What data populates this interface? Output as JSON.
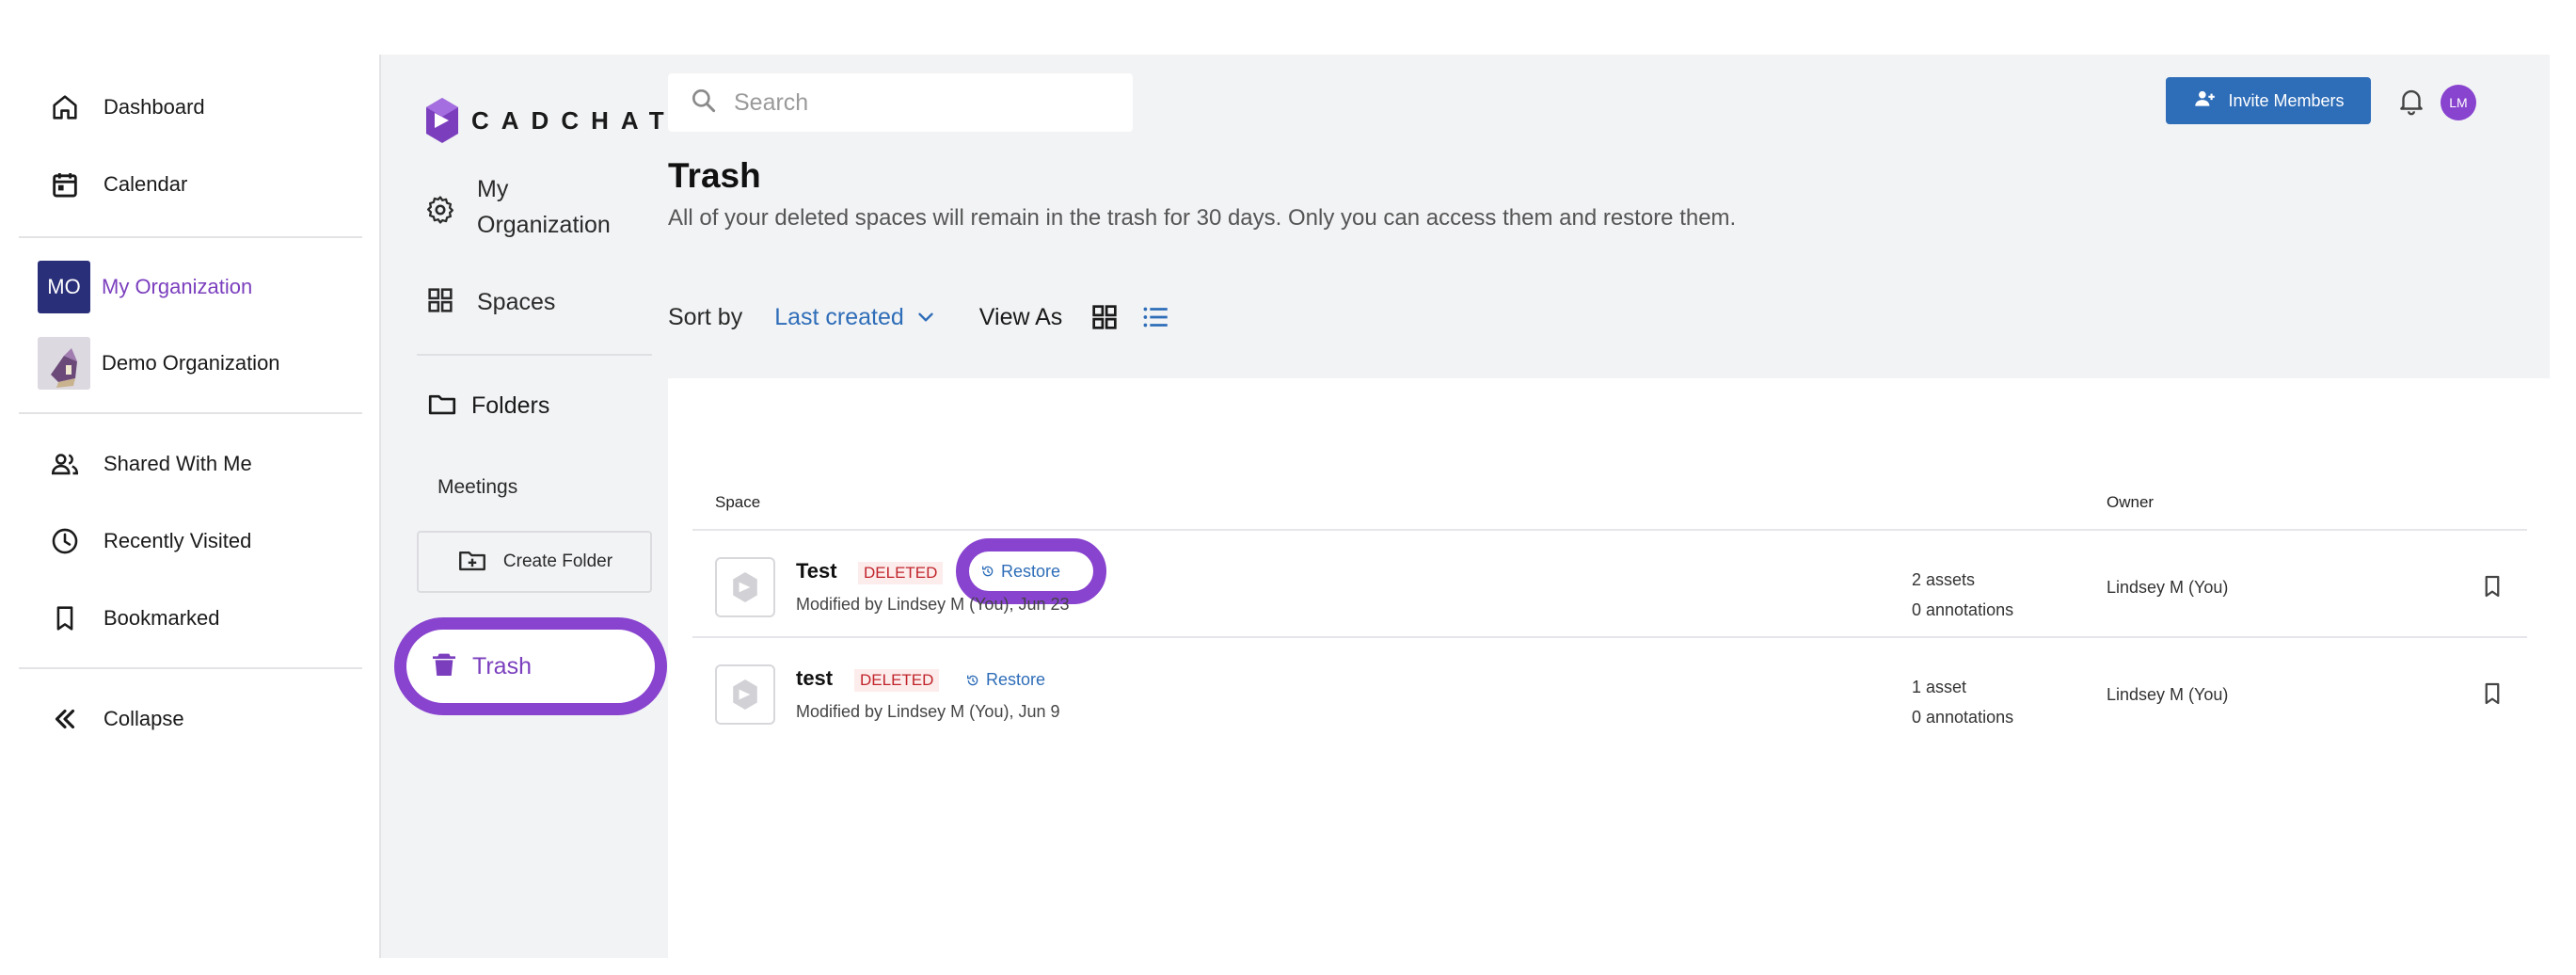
{
  "left_nav": {
    "items": [
      {
        "label": "Dashboard",
        "icon": "home-icon"
      },
      {
        "label": "Calendar",
        "icon": "calendar-icon"
      }
    ],
    "orgs": [
      {
        "badge": "MO",
        "label": "My Organization",
        "active": true
      },
      {
        "label": "Demo Organization"
      }
    ],
    "links": [
      {
        "label": "Shared With Me",
        "icon": "people-icon"
      },
      {
        "label": "Recently Visited",
        "icon": "clock-icon"
      },
      {
        "label": "Bookmarked",
        "icon": "bookmark-icon"
      }
    ],
    "collapse_label": "Collapse"
  },
  "panel": {
    "logo_text": "CADCHAT",
    "org_label": "My Organization",
    "spaces_label": "Spaces",
    "folders_label": "Folders",
    "meetings_label": "Meetings",
    "create_folder_label": "Create Folder",
    "trash_label": "Trash"
  },
  "header": {
    "search_placeholder": "Search",
    "invite_label": "Invite Members",
    "avatar_initials": "LM"
  },
  "page": {
    "title": "Trash",
    "subtitle": "All of your deleted spaces will remain in the trash for 30 days. Only you can access them and restore them.",
    "sort_label": "Sort by",
    "sort_value": "Last created",
    "view_label": "View As"
  },
  "table": {
    "columns": {
      "space": "Space",
      "owner": "Owner"
    },
    "rows": [
      {
        "name": "Test",
        "status": "DELETED",
        "restore": "Restore",
        "modified": "Modified by Lindsey M (You), Jun 23",
        "assets": "2 assets",
        "annotations": "0 annotations",
        "owner": "Lindsey M (You)"
      },
      {
        "name": "test",
        "status": "DELETED",
        "restore": "Restore",
        "modified": "Modified by Lindsey M (You), Jun 9",
        "assets": "1 asset",
        "annotations": "0 annotations",
        "owner": "Lindsey M (You)"
      }
    ]
  },
  "colors": {
    "accent_purple": "#8843cf",
    "primary_blue": "#2e6db8",
    "deleted_red": "#c0242b",
    "org_badge": "#2a2f7a"
  }
}
